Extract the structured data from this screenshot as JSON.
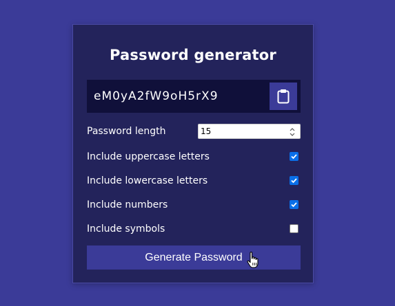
{
  "app": {
    "title": "Password generator"
  },
  "result": {
    "password": "eM0yA2fW9oH5rX9",
    "copy_icon": "clipboard-icon"
  },
  "settings": {
    "length": {
      "label": "Password length",
      "value": "15"
    },
    "uppercase": {
      "label": "Include uppercase letters",
      "checked": true
    },
    "lowercase": {
      "label": "Include lowercase letters",
      "checked": true
    },
    "numbers": {
      "label": "Include numbers",
      "checked": true
    },
    "symbols": {
      "label": "Include symbols",
      "checked": false
    }
  },
  "generate": {
    "label": "Generate Password"
  },
  "colors": {
    "background": "#3b3b98",
    "card": "#23235b",
    "result_bg": "#10103a",
    "accent": "#3b3b98",
    "checkbox": "#0a6fe8"
  },
  "cursor": {
    "icon": "hand-pointer-icon"
  }
}
